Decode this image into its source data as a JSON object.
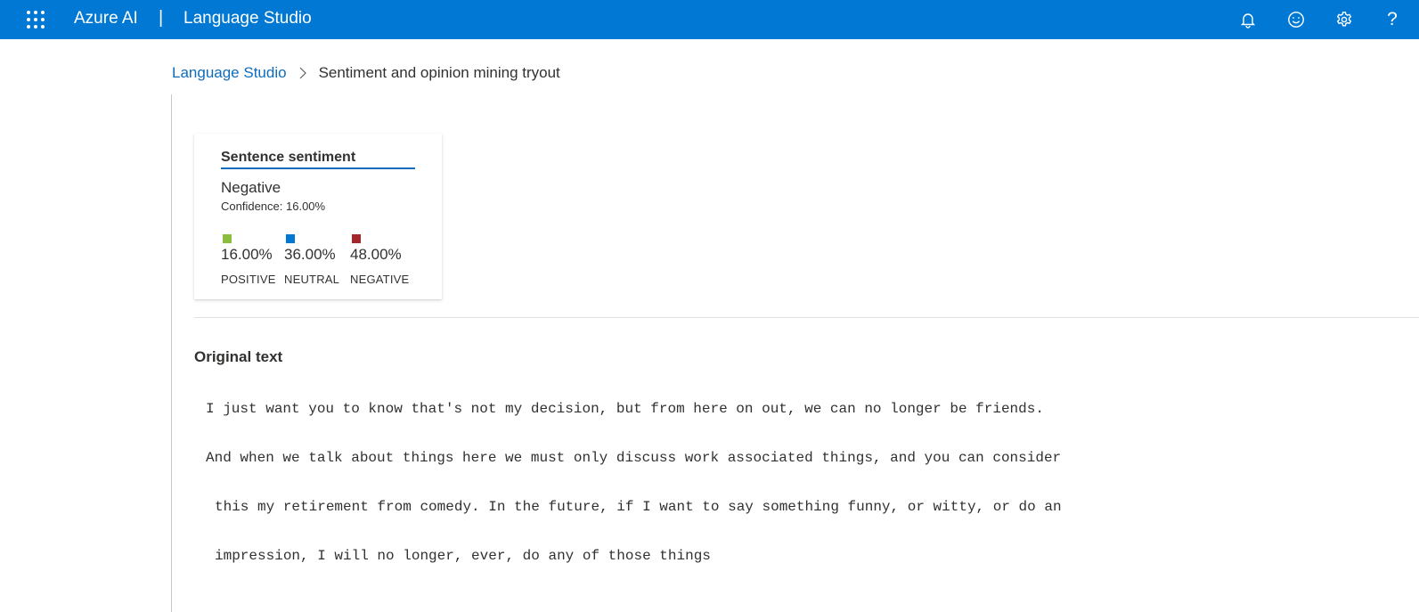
{
  "topbar": {
    "brand": "Azure AI",
    "separator": "|",
    "product": "Language Studio",
    "icons": [
      "waffle-icon",
      "bell-icon",
      "smiley-icon",
      "gear-icon",
      "help-icon"
    ],
    "help_glyph": "?"
  },
  "breadcrumb": {
    "root": "Language Studio",
    "current": "Sentiment and opinion mining tryout"
  },
  "sentiment_card": {
    "title": "Sentence sentiment",
    "label": "Negative",
    "confidence": "Confidence: 16.00%",
    "scores": [
      {
        "percent": "16.00%",
        "name": "POSITIVE",
        "color": "#8cbd3f"
      },
      {
        "percent": "36.00%",
        "name": "NEUTRAL",
        "color": "#0078d4"
      },
      {
        "percent": "48.00%",
        "name": "NEGATIVE",
        "color": "#a4262c"
      }
    ]
  },
  "original_text": {
    "title": "Original text",
    "lines": [
      "I just want you to know that's not my decision, but from here on out, we can no longer be friends.",
      "And when we talk about things here we must only discuss work associated things, and you can consider",
      "this my retirement from comedy. In the future, if I want to say something funny, or witty, or do an",
      "impression, I will no longer, ever, do any of those things"
    ]
  },
  "colors": {
    "topbar": "#0078d4",
    "link": "#0f6cbd"
  }
}
